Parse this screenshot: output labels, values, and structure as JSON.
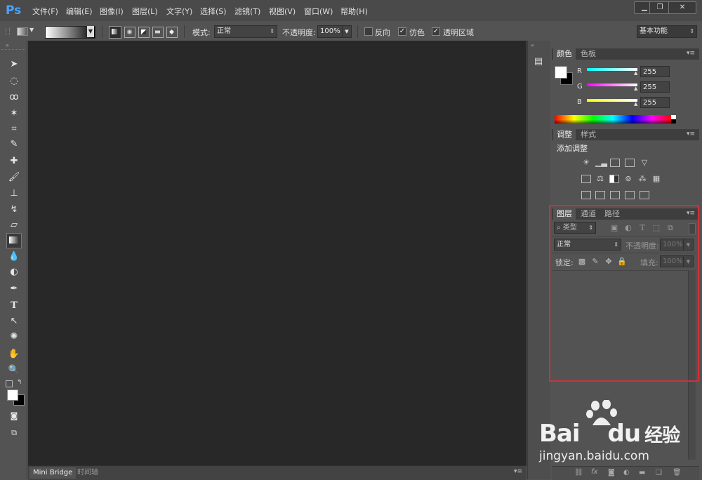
{
  "app": {
    "logo": "Ps"
  },
  "menu": [
    "文件(F)",
    "编辑(E)",
    "图像(I)",
    "图层(L)",
    "文字(Y)",
    "选择(S)",
    "滤镜(T)",
    "视图(V)",
    "窗口(W)",
    "帮助(H)"
  ],
  "window_buttons": {
    "minimize": "▁",
    "maximize": "❐",
    "close": "✕"
  },
  "options": {
    "mode_label": "模式:",
    "mode_value": "正常",
    "opacity_label": "不透明度:",
    "opacity_value": "100%",
    "reverse": "反向",
    "dither": "仿色",
    "transparency": "透明区域",
    "workspace": "基本功能"
  },
  "color_panel": {
    "tabs": [
      "颜色",
      "色板"
    ],
    "r_label": "R",
    "g_label": "G",
    "b_label": "B",
    "r_value": "255",
    "g_value": "255",
    "b_value": "255"
  },
  "adjust_panel": {
    "tabs": [
      "调整",
      "样式"
    ],
    "title": "添加调整"
  },
  "layers_panel": {
    "tabs": [
      "图层",
      "通道",
      "路径"
    ],
    "filter_kind": "类型",
    "blend_mode": "正常",
    "opacity_label": "不透明度:",
    "opacity_value": "100%",
    "lock_label": "锁定:",
    "fill_label": "填充:",
    "fill_value": "100%"
  },
  "bottom_tabs": [
    "Mini Bridge",
    "时间轴"
  ],
  "watermark": {
    "brand": "Bai",
    "brand2": "du",
    "sub": "经验",
    "url": "jingyan.baidu.com"
  },
  "colors": {
    "highlight_box": "#d0303a",
    "logo": "#4aa3ff"
  }
}
